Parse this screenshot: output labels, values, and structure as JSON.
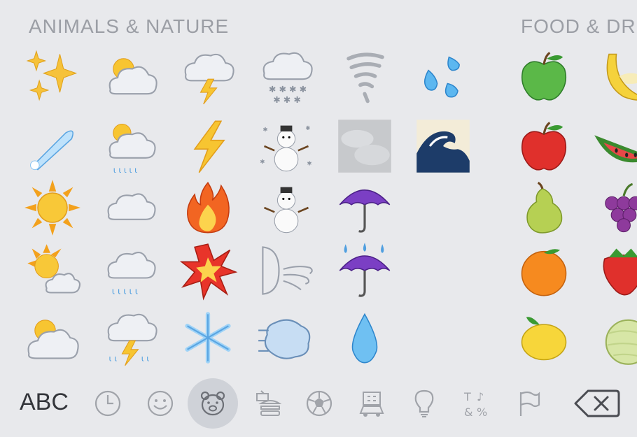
{
  "sections": {
    "animals_title": "ANIMALS & NATURE",
    "food_title": "FOOD & DRI"
  },
  "emoji_grid": [
    {
      "row": 0,
      "items": [
        "sparkles",
        "sun-behind-cloud",
        "cloud-with-lightning",
        "cloud-with-snow",
        "tornado",
        "sweat-droplets",
        "green-apple",
        "banana"
      ]
    },
    {
      "row": 1,
      "items": [
        "comet",
        "sun-behind-rain-cloud",
        "high-voltage",
        "snowman-with-snow",
        "fog",
        "water-wave",
        "red-apple",
        "watermelon"
      ]
    },
    {
      "row": 2,
      "items": [
        "sun",
        "cloud",
        "fire",
        "snowman",
        "umbrella",
        "",
        "pear",
        "grapes"
      ]
    },
    {
      "row": 3,
      "items": [
        "sun-behind-small-cloud",
        "cloud-with-rain",
        "collision",
        "wind-face",
        "umbrella-with-rain-drops",
        "",
        "tangerine",
        "strawberry"
      ]
    },
    {
      "row": 4,
      "items": [
        "sun-behind-large-cloud",
        "cloud-with-lightning-and-rain",
        "snowflake",
        "dashing-away",
        "droplet",
        "",
        "lemon",
        "melon"
      ]
    }
  ],
  "bottom_bar": {
    "abc_label": "ABC",
    "categories": [
      {
        "name": "recent",
        "icon": "clock-icon",
        "selected": false
      },
      {
        "name": "smileys",
        "icon": "smiley-icon",
        "selected": false
      },
      {
        "name": "animals-nature",
        "icon": "bear-icon",
        "selected": true
      },
      {
        "name": "food-drink",
        "icon": "burger-icon",
        "selected": false
      },
      {
        "name": "activity",
        "icon": "soccer-ball-icon",
        "selected": false
      },
      {
        "name": "travel-places",
        "icon": "building-car-icon",
        "selected": false
      },
      {
        "name": "objects",
        "icon": "lightbulb-icon",
        "selected": false
      },
      {
        "name": "symbols",
        "icon": "symbols-icon",
        "selected": false
      },
      {
        "name": "flags",
        "icon": "flag-icon",
        "selected": false
      }
    ],
    "delete_icon": "backspace-icon"
  },
  "colors": {
    "background": "#e8e9ec",
    "section_title": "#9b9ea5",
    "icon_gray": "#a0a3a9",
    "selected_bg": "#cfd2d8"
  }
}
